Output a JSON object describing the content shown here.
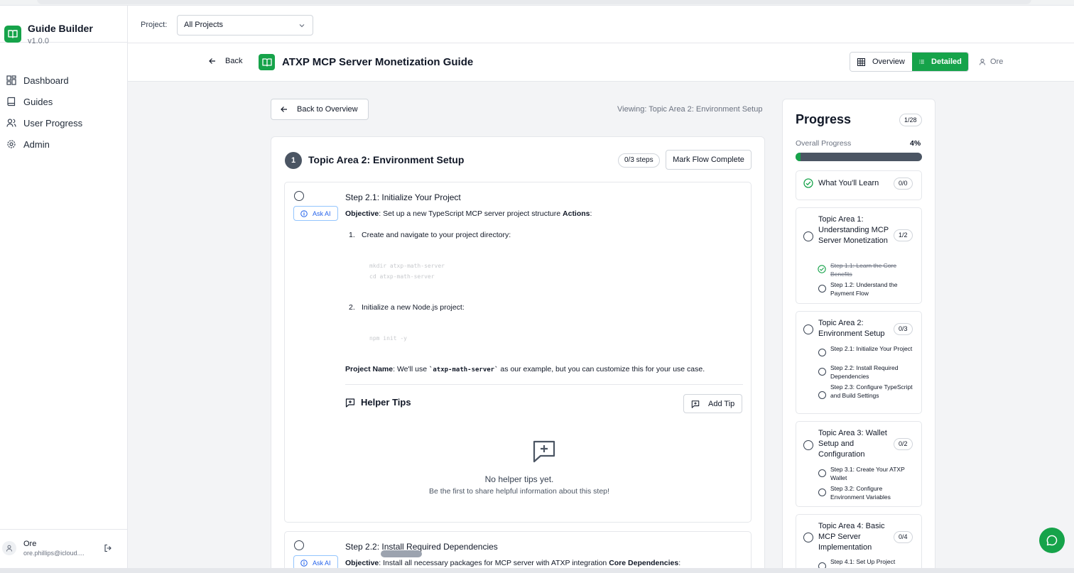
{
  "app": {
    "name": "Guide Builder",
    "version": "v1.0.0"
  },
  "sidebar": {
    "items": [
      {
        "label": "Dashboard",
        "icon": "dashboard-icon"
      },
      {
        "label": "Guides",
        "icon": "book-icon"
      },
      {
        "label": "User Progress",
        "icon": "users-icon"
      },
      {
        "label": "Admin",
        "icon": "gear-icon"
      }
    ],
    "user": {
      "name": "Ore",
      "email": "ore.phillips@icloud...."
    }
  },
  "project_bar": {
    "label": "Project:",
    "selected": "All Projects"
  },
  "guide_header": {
    "back": "Back",
    "title": "ATXP MCP Server Monetization Guide",
    "view_overview": "Overview",
    "view_detailed": "Detailed",
    "user": "Ore"
  },
  "main": {
    "back_to_overview": "Back to Overview",
    "viewing": "Viewing: Topic Area 2: Environment Setup",
    "flow": {
      "number": "1",
      "title": "Topic Area 2: Environment Setup",
      "steps_badge": "0/3 steps",
      "mark_complete": "Mark Flow Complete"
    },
    "step1": {
      "ask_ai": "Ask AI",
      "title": "Step 2.1: Initialize Your Project",
      "objective_label": "Objective",
      "objective_text": ": Set up a new TypeScript MCP server project structure ",
      "actions_label": "Actions",
      "actions_suffix": ":",
      "item1_num": "1.",
      "item1": "Create and navigate to your project directory:",
      "code1": "mkdir atxp-math-server\ncd atxp-math-server",
      "item2_num": "2.",
      "item2": "Initialize a new Node.js project:",
      "code2": "npm init -y",
      "project_name_label": "Project Name",
      "project_name_prefix": ": We'll use ",
      "project_name_code": "`atxp-math-server`",
      "project_name_suffix": " as our example, but you can customize this for your use case.",
      "helper_tips": "Helper Tips",
      "add_tip": "Add Tip",
      "empty_title": "No helper tips yet.",
      "empty_sub": "Be the first to share helpful information about this step!"
    },
    "step2": {
      "ask_ai": "Ask AI",
      "title": "Step 2.2: Install Required Dependencies",
      "objective_label": "Objective",
      "objective_text": ": Install all necessary packages for MCP server with ATXP integration ",
      "core_label": "Core Dependencies",
      "core_suffix": ":"
    }
  },
  "progress": {
    "title": "Progress",
    "badge": "1/28",
    "overall_label": "Overall Progress",
    "percent_text": "4%",
    "percent_value": 4,
    "learn": {
      "title": "What You'll Learn",
      "badge": "0/0"
    },
    "topics": [
      {
        "title": "Topic Area 1: Understanding MCP Server Monetization",
        "badge": "1/2",
        "steps": [
          {
            "label": "Step 1.1: Learn the Core Benefits",
            "done": true
          },
          {
            "label": "Step 1.2: Understand the Payment Flow",
            "done": false
          }
        ]
      },
      {
        "title": "Topic Area 2: Environment Setup",
        "badge": "0/3",
        "steps": [
          {
            "label": "Step 2.1: Initialize Your Project",
            "done": false
          },
          {
            "label": "Step 2.2: Install Required Dependencies",
            "done": false
          },
          {
            "label": "Step 2.3: Configure TypeScript and Build Settings",
            "done": false
          }
        ]
      },
      {
        "title": "Topic Area 3: Wallet Setup and Configuration",
        "badge": "0/2",
        "steps": [
          {
            "label": "Step 3.1: Create Your ATXP Wallet",
            "done": false
          },
          {
            "label": "Step 3.2: Configure Environment Variables",
            "done": false
          }
        ]
      },
      {
        "title": "Topic Area 4: Basic MCP Server Implementation",
        "badge": "0/4",
        "steps": [
          {
            "label": "Step 4.1: Set Up Project",
            "done": false
          }
        ]
      }
    ]
  },
  "colors": {
    "accent": "#16a34a",
    "bar_track": "#4b5563",
    "ask_ai": "#2563eb"
  }
}
